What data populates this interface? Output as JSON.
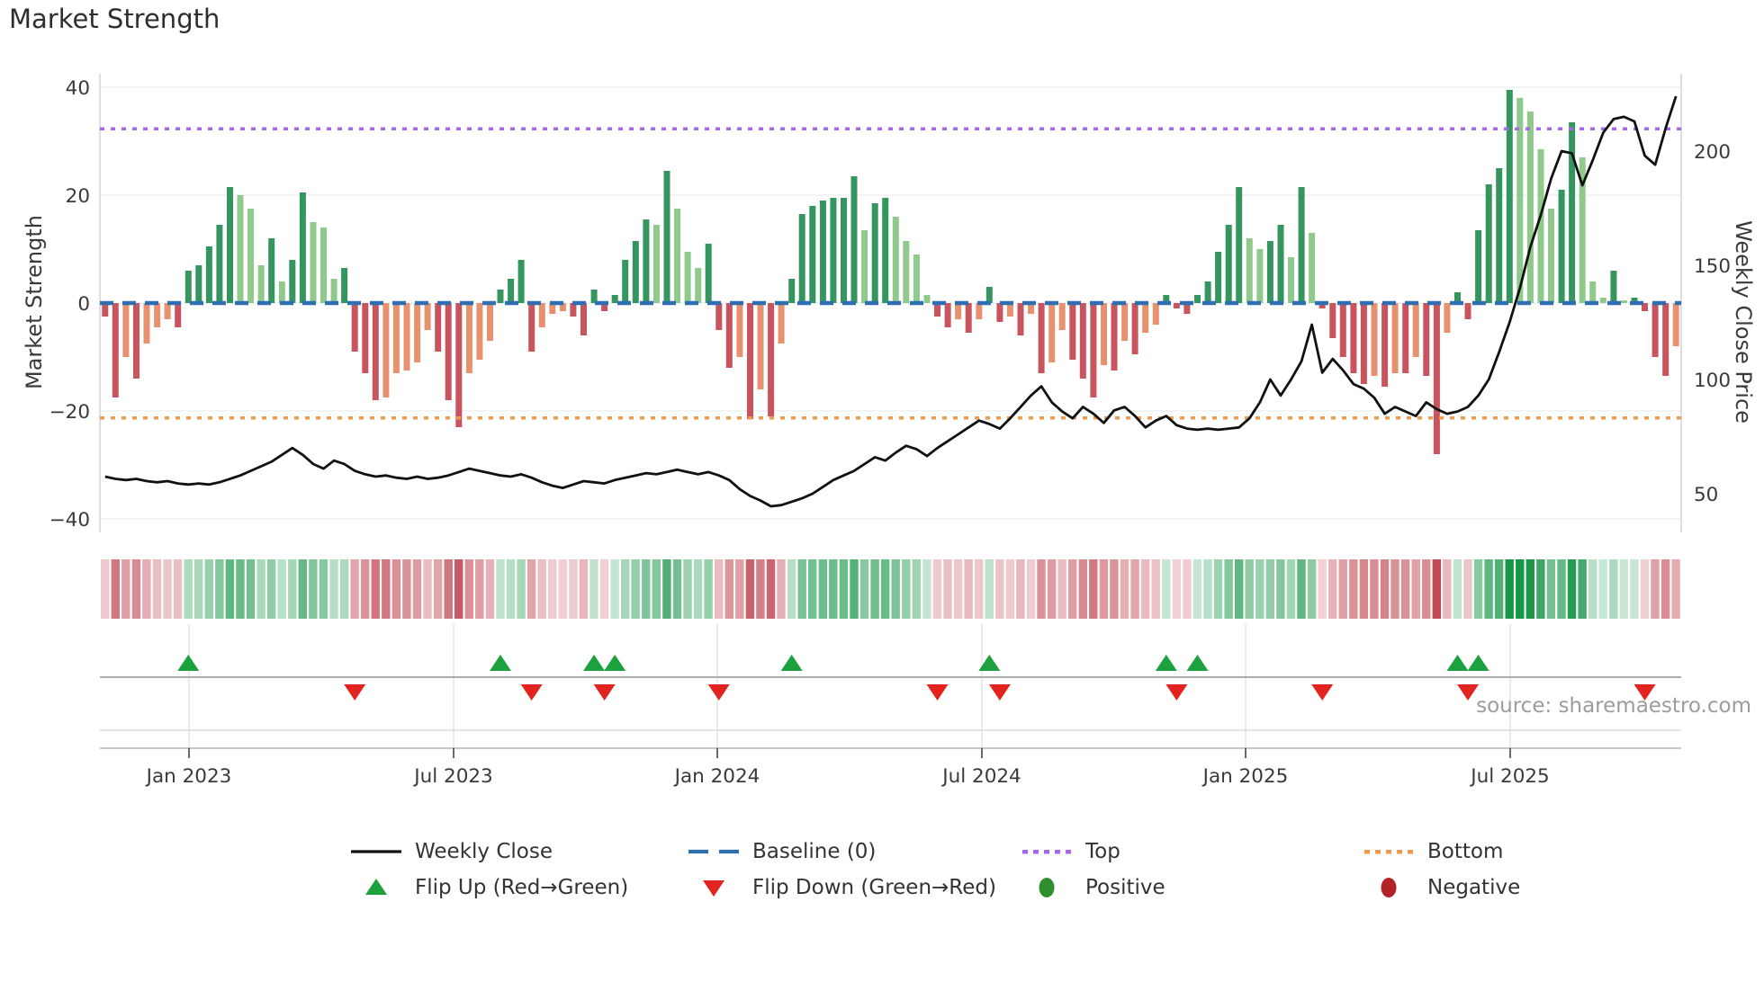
{
  "title": "Market Strength",
  "annotations": {
    "source": "source: sharemaestro.com"
  },
  "axes": {
    "left_label": "Market Strength",
    "right_label": "Weekly Close Price",
    "left_ticks": [
      40,
      20,
      0,
      -20,
      -40
    ],
    "right_ticks": [
      200,
      150,
      100,
      50
    ],
    "x_tick_labels": [
      "Jan 2023",
      "Jul 2023",
      "Jan 2024",
      "Jul 2024",
      "Jan 2025",
      "Jul 2025"
    ]
  },
  "legend": {
    "row1": [
      {
        "label": "Weekly Close",
        "swatch": "line-black"
      },
      {
        "label": "Baseline (0)",
        "swatch": "dash-blue"
      },
      {
        "label": "Top",
        "swatch": "dot-purple"
      },
      {
        "label": "Bottom",
        "swatch": "dot-orange"
      }
    ],
    "row2": [
      {
        "label": "Flip Up (Red→Green)",
        "swatch": "triangle-up-green"
      },
      {
        "label": "Flip Down (Green→Red)",
        "swatch": "triangle-down-red"
      },
      {
        "label": "Positive",
        "swatch": "circle-green"
      },
      {
        "label": "Negative",
        "swatch": "circle-darkred"
      }
    ]
  },
  "colors": {
    "bar_pos_rising": "#35955e",
    "bar_pos_falling": "#8fc98c",
    "bar_neg_falling": "#c9545e",
    "bar_neg_recovering": "#e8916e",
    "price_line": "#111111",
    "baseline": "#2e6fb3",
    "top_line": "#a568e8",
    "bottom_line": "#f09a4e",
    "flip_up": "#1ba13e",
    "flip_down": "#e2231f",
    "legend_positive": "#2f8f2f",
    "legend_negative": "#b22228",
    "heat_green": "#189648",
    "heat_red": "#c24a55",
    "grid": "#eceef4",
    "spine": "#d4d4d8",
    "tick_text": "#3a3a3a"
  },
  "chart_data": {
    "type": "combo",
    "description": "Weekly Market Strength bars (left axis) with Weekly Close price line (right axis), heatmap strip and flip markers",
    "n_weeks": 152,
    "x_tick_labels": [
      "Jan 2023",
      "Jul 2023",
      "Jan 2024",
      "Jul 2024",
      "Jan 2025",
      "Jul 2025"
    ],
    "ylim_left": [
      -42.5,
      42.5
    ],
    "ylim_right": [
      33,
      234
    ],
    "baseline": 0,
    "top_threshold": 32.3,
    "bottom_threshold": -21.3,
    "series": [
      {
        "name": "Market Strength",
        "type": "bar",
        "axis": "left",
        "values": [
          -2.5,
          -17.5,
          -10,
          -14,
          -7.5,
          -4.5,
          -3,
          -4.5,
          6,
          7,
          10.5,
          14.5,
          21.5,
          20,
          17.5,
          7,
          12,
          4,
          8,
          20.5,
          15,
          14,
          4.5,
          6.5,
          -9,
          -13,
          -18,
          -17.5,
          -13,
          -12.5,
          -11,
          -5,
          -9,
          -18,
          -23,
          -13,
          -10.5,
          -7,
          2.5,
          4.5,
          8,
          -9,
          -4.5,
          -2,
          -1.5,
          -2.5,
          -6,
          2.5,
          -1.5,
          1.5,
          8,
          11.5,
          15.5,
          14.5,
          24.5,
          17.5,
          9.5,
          6.5,
          11,
          -5,
          -12,
          -10,
          -21.5,
          -16,
          -21,
          -7.5,
          4.5,
          16.5,
          18,
          19,
          19.5,
          19.5,
          23.5,
          13.5,
          18.5,
          19.5,
          16,
          11.5,
          9,
          1.5,
          -2.5,
          -4.5,
          -3,
          -5.5,
          -3,
          3,
          -3.5,
          -2.5,
          -6,
          -2,
          -13,
          -11,
          -5,
          -10.5,
          -14,
          -17.5,
          -11.5,
          -12.5,
          -7,
          -9.5,
          -5.5,
          -4,
          1.5,
          -1,
          -2,
          1.5,
          4,
          9.5,
          14.5,
          21.5,
          12,
          10,
          11.5,
          14.5,
          8.5,
          21.5,
          13,
          -1,
          -6.5,
          -10,
          -13,
          -15,
          -13.5,
          -15.5,
          -13,
          -13,
          -10,
          -13.5,
          -28,
          -5.5,
          2,
          -3,
          13.5,
          22,
          25,
          39.5,
          38,
          35.5,
          28.5,
          17.5,
          21,
          33.5,
          27,
          4,
          1,
          6,
          0.5,
          1,
          -1.5,
          -10,
          -13.5,
          -8
        ]
      },
      {
        "name": "Weekly Close",
        "type": "line",
        "axis": "right",
        "values": [
          57.5,
          56.5,
          56,
          56.5,
          55.5,
          55,
          55.5,
          54.5,
          54,
          54.5,
          54,
          55,
          56.5,
          58,
          60,
          62,
          64,
          67,
          70,
          67,
          63,
          61,
          64.5,
          63,
          60,
          58.5,
          57.5,
          58,
          57,
          56.5,
          57.5,
          56.5,
          57,
          58,
          59.5,
          61,
          60,
          59,
          58,
          57.5,
          58.5,
          57,
          55,
          53.5,
          52.5,
          54,
          55.5,
          55,
          54.5,
          56,
          57,
          58,
          59,
          58.5,
          59.5,
          60.5,
          59.5,
          58.5,
          59.5,
          58,
          56,
          52,
          49,
          47,
          44.5,
          45,
          46.5,
          48,
          50,
          53,
          56,
          58,
          60,
          63,
          66,
          64.5,
          68,
          71,
          69.5,
          66.5,
          70,
          73,
          76,
          79,
          82,
          80.5,
          78.5,
          83,
          88,
          93,
          97,
          90,
          86,
          83,
          88,
          85,
          81,
          86.5,
          88,
          84,
          79,
          82,
          84,
          80,
          78.5,
          78,
          78.5,
          78,
          78.5,
          79,
          83,
          90,
          100,
          93,
          100,
          108,
          124,
          103,
          109,
          104,
          98,
          96,
          92,
          85,
          88,
          86,
          84,
          90,
          87,
          85,
          86,
          88,
          93,
          100,
          112,
          125,
          140,
          158,
          172,
          188,
          200,
          199,
          185,
          196,
          208,
          214,
          215,
          213,
          198,
          194,
          210,
          224
        ]
      }
    ],
    "heatmap": "same values as Market Strength bars, red-to-green intensity strip",
    "flip_up_weeks": [
      8,
      38,
      47,
      49,
      66,
      85,
      102,
      105,
      130,
      132
    ],
    "flip_down_weeks": [
      24,
      41,
      48,
      59,
      80,
      86,
      103,
      117,
      131,
      148
    ]
  }
}
